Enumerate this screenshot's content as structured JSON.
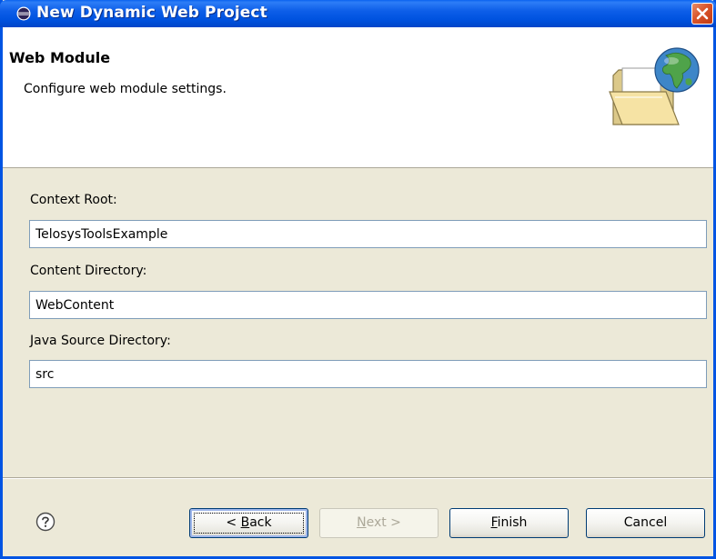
{
  "window": {
    "title": "New Dynamic Web Project"
  },
  "banner": {
    "title": "Web Module",
    "description": "Configure web module settings."
  },
  "form": {
    "context_root": {
      "label": "Context Root:",
      "value": "TelosysToolsExample"
    },
    "content_directory": {
      "label": "Content Directory:",
      "value": "WebContent"
    },
    "java_source_directory": {
      "label": "Java Source Directory:",
      "value": "src"
    }
  },
  "buttons": {
    "back": {
      "prefix": "< ",
      "mnemonic": "B",
      "rest": "ack",
      "enabled": true
    },
    "next": {
      "mnemonic": "N",
      "rest": "ext >",
      "enabled": false
    },
    "finish": {
      "mnemonic": "F",
      "rest": "inish",
      "enabled": true
    },
    "cancel": {
      "label": "Cancel",
      "enabled": true
    }
  },
  "colors": {
    "titlebar": "#0054e3",
    "dialog_bg": "#ece9d8",
    "close_button": "#d9542a"
  },
  "icons": {
    "title": "eclipse-icon",
    "close": "close-icon",
    "banner": "folder-globe-icon",
    "help": "help-icon"
  }
}
